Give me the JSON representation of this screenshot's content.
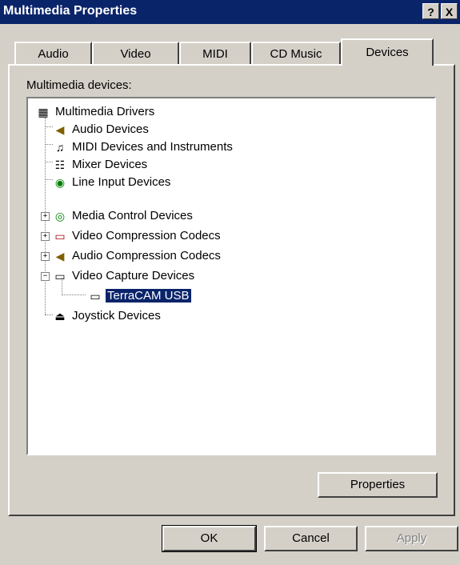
{
  "window": {
    "title": "Multimedia Properties"
  },
  "caption_buttons": {
    "help": "?",
    "close": "X"
  },
  "tabs": [
    {
      "label": "Audio"
    },
    {
      "label": "Video"
    },
    {
      "label": "MIDI"
    },
    {
      "label": "CD Music"
    },
    {
      "label": "Devices",
      "active": true
    }
  ],
  "devices": {
    "group_label": "Multimedia devices:",
    "tree": [
      {
        "label": "Multimedia Drivers",
        "icon": "multimedia-drivers-icon"
      },
      {
        "label": "Audio Devices",
        "icon": "speaker-icon"
      },
      {
        "label": "MIDI Devices and Instruments",
        "icon": "midi-icon"
      },
      {
        "label": "Mixer Devices",
        "icon": "mixer-icon"
      },
      {
        "label": "Line Input Devices",
        "icon": "line-input-icon"
      },
      {
        "label": "Media Control Devices",
        "icon": "media-control-icon",
        "expander": "+"
      },
      {
        "label": "Video Compression Codecs",
        "icon": "video-codec-icon",
        "expander": "+"
      },
      {
        "label": "Audio Compression Codecs",
        "icon": "audio-codec-icon",
        "expander": "+"
      },
      {
        "label": "Video Capture Devices",
        "icon": "video-capture-icon",
        "expander": "−"
      },
      {
        "label": "TerraCAM USB",
        "icon": "camera-icon",
        "selected": true
      },
      {
        "label": "Joystick Devices",
        "icon": "joystick-icon"
      }
    ],
    "properties_button": "Properties"
  },
  "footer": {
    "ok": "OK",
    "cancel": "Cancel",
    "apply": "Apply"
  }
}
